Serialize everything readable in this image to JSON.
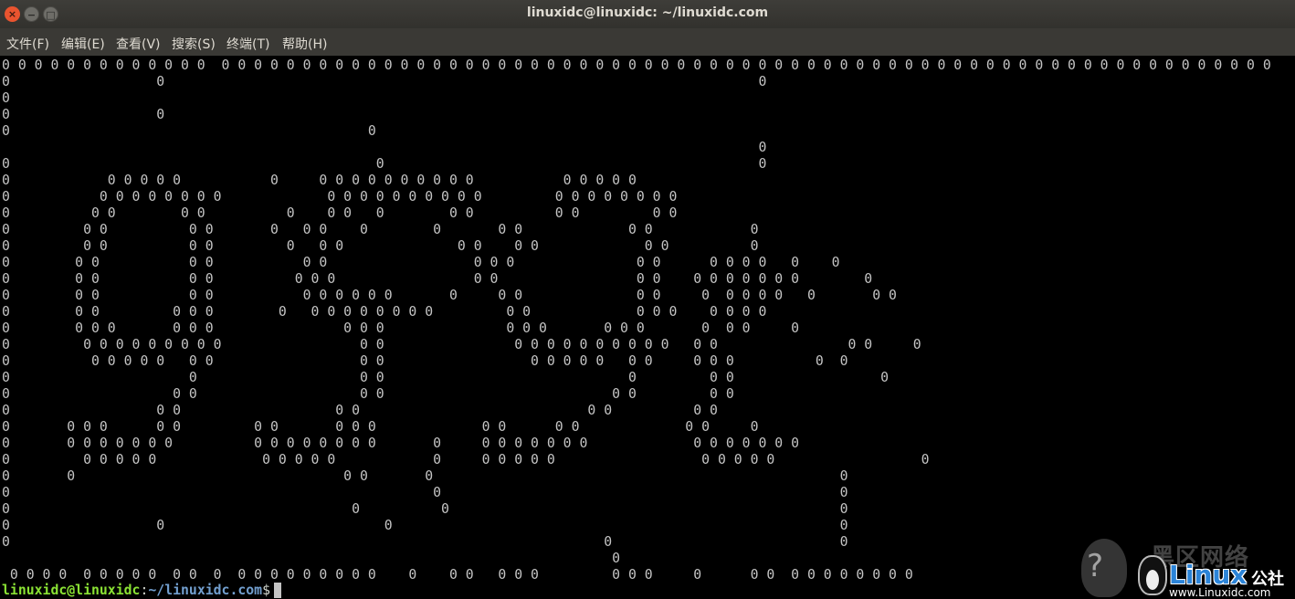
{
  "window": {
    "title": "linuxidc@linuxidc: ~/linuxidc.com",
    "close_glyph": "×",
    "minimize_glyph": "−",
    "maximize_glyph": "□"
  },
  "menu": [
    {
      "label": "文件(F)"
    },
    {
      "label": "编辑(E)"
    },
    {
      "label": "查看(V)"
    },
    {
      "label": "搜索(S)"
    },
    {
      "label": "终端(T)"
    },
    {
      "label": "帮助(H)"
    }
  ],
  "terminal": {
    "screen_rows": [
      "0 0 0 0 0 0 0 0 0 0 0 0 0  0 0 0 0 0 0 0 0 0 0 0 0 0 0 0 0 0 0 0 0 0 0 0 0 0 0 0 0 0 0 0 0 0 0 0 0 0 0 0 0 0 0 0 0 0 0 0 0 0 0 0 0 0 0 0 0 0 0 0 0 0 0 0 0 0",
      "0                  0                                                                         0",
      "0",
      "0                  0",
      "0                                            0",
      "                                                                                             0",
      "0                                             0                                              0",
      "0            0 0 0 0 0           0     0 0 0 0 0 0 0 0 0 0           0 0 0 0 0",
      "0           0 0 0 0 0 0 0 0             0 0 0 0 0 0 0 0 0 0         0 0 0 0 0 0 0 0",
      "0          0 0        0 0          0    0 0   0        0 0          0 0         0 0",
      "0         0 0          0 0       0   0 0    0        0       0 0             0 0            0",
      "0         0 0          0 0         0   0 0              0 0    0 0             0 0          0",
      "0        0 0           0 0           0 0                  0 0 0               0 0      0 0 0 0   0    0",
      "0        0 0           0 0          0 0 0                 0 0                 0 0    0 0 0 0 0 0 0        0",
      "0        0 0           0 0           0 0 0 0 0 0       0     0 0              0 0     0  0 0 0 0   0       0 0",
      "0        0 0         0 0 0        0   0 0 0 0 0 0 0 0         0 0             0 0 0    0 0 0 0",
      "0        0 0 0       0 0 0                0 0 0               0 0 0       0 0 0       0  0 0     0",
      "0         0 0 0 0 0 0 0 0 0                 0 0                0 0 0 0 0 0 0 0 0 0   0 0                0 0     0",
      "0          0 0 0 0 0   0 0                  0 0                  0 0 0 0 0   0 0     0 0 0          0  0",
      "0                      0                    0 0                              0         0 0                  0",
      "0                    0 0                    0 0                            0 0         0 0",
      "0                  0 0                   0 0                            0 0          0 0",
      "0       0 0 0      0 0         0 0       0 0 0             0 0      0 0             0 0     0",
      "0       0 0 0 0 0 0 0          0 0 0 0 0 0 0 0       0     0 0 0 0 0 0 0             0 0 0 0 0 0 0",
      "0         0 0 0 0 0             0 0 0 0 0            0     0 0 0 0 0                  0 0 0 0 0                  0",
      "0       0                                 0 0       0                                                  0",
      "0                                                    0                                                 0",
      "0                                          0          0                                                0",
      "0                  0                           0                                                       0",
      "0                                                                         0                            0",
      "                                                                           0",
      " 0 0 0 0  0 0 0 0 0  0 0  0  0 0 0 0 0 0 0 0 0    0    0 0   0 0 0         0 0 0     0      0 0  0 0 0 0 0 0 0 0"
    ],
    "prompt_user_host": "linuxidc@linuxidc",
    "prompt_colon": ":",
    "prompt_path": "~/linuxidc.com",
    "prompt_symbol": "$"
  },
  "watermark": {
    "cn_title": "黑区网络",
    "brand": "Linux",
    "brand_suffix": "公社",
    "url": "www.Linuxidc.com"
  },
  "colors": {
    "prompt_user": "#8ae234",
    "prompt_path": "#729fcf",
    "terminal_fg": "#c4c4c4",
    "terminal_bg": "#000000",
    "titlebar_bg": "#3e3d39",
    "close_button": "#e9542f"
  }
}
